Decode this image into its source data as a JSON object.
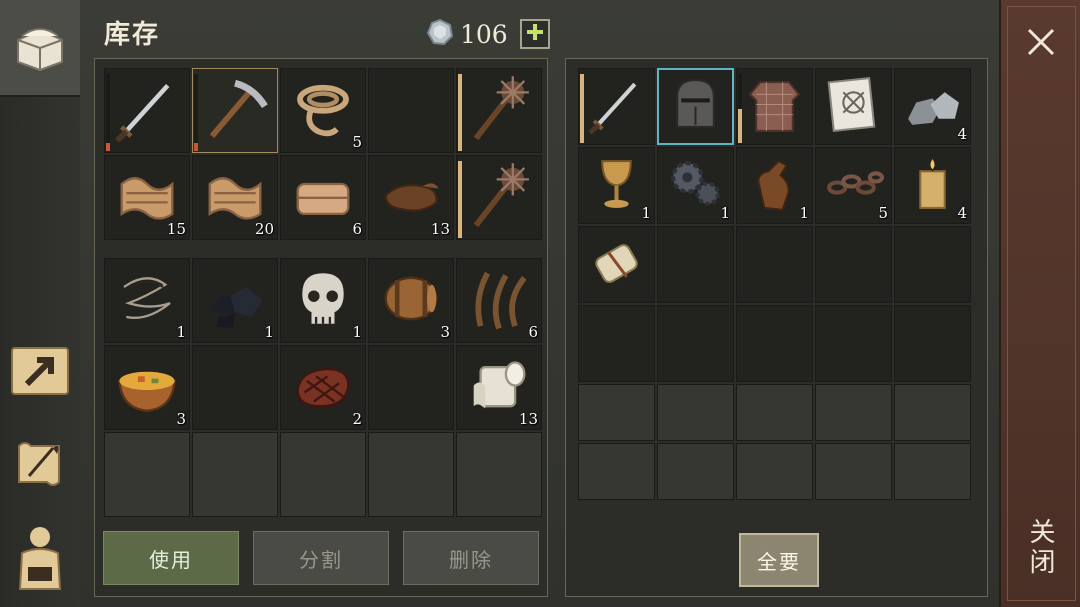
{
  "header": {
    "title": "库存",
    "currency_icon": "silver-coin-icon",
    "currency_value": "106",
    "add_icon": "plus-icon"
  },
  "sidebar": {
    "items": [
      {
        "icon": "chest-icon",
        "active": true
      },
      {
        "icon": "craft-arrow-icon",
        "active": false
      },
      {
        "icon": "scroll-quill-icon",
        "active": false
      },
      {
        "icon": "backpack-icon",
        "active": false
      }
    ]
  },
  "inventory": {
    "equipment": [
      {
        "item": "sword",
        "count": "",
        "durability": 0.1,
        "dura_color": "#c8563b"
      },
      {
        "item": "pickaxe",
        "count": "",
        "durability": 0.1,
        "dura_color": "#c8563b",
        "selected": true
      },
      {
        "item": "rope",
        "count": "5"
      },
      {
        "item": "empty",
        "count": ""
      },
      {
        "item": "mace",
        "count": "",
        "durability": 1.0,
        "dura_color": "#d8b57c"
      },
      {
        "item": "fabric",
        "count": "15"
      },
      {
        "item": "fabric",
        "count": "20"
      },
      {
        "item": "cloth-bolt",
        "count": "6"
      },
      {
        "item": "leather",
        "count": "13"
      },
      {
        "item": "mace",
        "count": "",
        "durability": 1.0,
        "dura_color": "#d8b57c"
      }
    ],
    "bag": [
      {
        "item": "thread",
        "count": "1"
      },
      {
        "item": "coal",
        "count": "1"
      },
      {
        "item": "skull",
        "count": "1"
      },
      {
        "item": "barrel",
        "count": "3"
      },
      {
        "item": "fibers",
        "count": "6"
      },
      {
        "item": "stew",
        "count": "3"
      },
      {
        "item": "empty",
        "count": ""
      },
      {
        "item": "steak",
        "count": "2"
      },
      {
        "item": "empty",
        "count": ""
      },
      {
        "item": "paper-roll",
        "count": "13"
      },
      {
        "item": "empty",
        "count": "",
        "dim": true
      },
      {
        "item": "empty",
        "count": "",
        "dim": true
      },
      {
        "item": "empty",
        "count": "",
        "dim": true
      },
      {
        "item": "empty",
        "count": "",
        "dim": true
      },
      {
        "item": "empty",
        "count": "",
        "dim": true
      }
    ]
  },
  "loot": {
    "slots": [
      {
        "item": "sword",
        "count": "",
        "durability": 1.0,
        "dura_color": "#d8b57c"
      },
      {
        "item": "helmet",
        "count": "",
        "highlight": true
      },
      {
        "item": "chainmail",
        "count": "",
        "durability": 0.5,
        "dura_color": "#d8b57c"
      },
      {
        "item": "blueprint",
        "count": ""
      },
      {
        "item": "stone",
        "count": "4"
      },
      {
        "item": "goblet",
        "count": "1"
      },
      {
        "item": "gears",
        "count": "1"
      },
      {
        "item": "bottle",
        "count": "1"
      },
      {
        "item": "chain",
        "count": "5"
      },
      {
        "item": "candle",
        "count": "4"
      },
      {
        "item": "scroll",
        "count": ""
      },
      {
        "item": "empty",
        "count": ""
      },
      {
        "item": "empty",
        "count": ""
      },
      {
        "item": "empty",
        "count": ""
      },
      {
        "item": "empty",
        "count": ""
      },
      {
        "item": "empty",
        "count": ""
      },
      {
        "item": "empty",
        "count": ""
      },
      {
        "item": "empty",
        "count": ""
      },
      {
        "item": "empty",
        "count": ""
      },
      {
        "item": "empty",
        "count": ""
      },
      {
        "item": "empty",
        "count": "",
        "dim": true
      },
      {
        "item": "empty",
        "count": "",
        "dim": true
      },
      {
        "item": "empty",
        "count": "",
        "dim": true
      },
      {
        "item": "empty",
        "count": "",
        "dim": true
      },
      {
        "item": "empty",
        "count": "",
        "dim": true
      },
      {
        "item": "empty",
        "count": "",
        "dim": true
      },
      {
        "item": "empty",
        "count": "",
        "dim": true
      },
      {
        "item": "empty",
        "count": "",
        "dim": true
      },
      {
        "item": "empty",
        "count": "",
        "dim": true
      },
      {
        "item": "empty",
        "count": "",
        "dim": true
      }
    ]
  },
  "buttons": {
    "use": "使用",
    "split": "分割",
    "delete": "删除",
    "take_all": "全要"
  },
  "close": {
    "label": "关闭",
    "icon": "close-icon"
  },
  "colors": {
    "use_button": "#5c6a48",
    "close_strip": "#5a3a2e",
    "highlight": "#5fb6c2"
  }
}
